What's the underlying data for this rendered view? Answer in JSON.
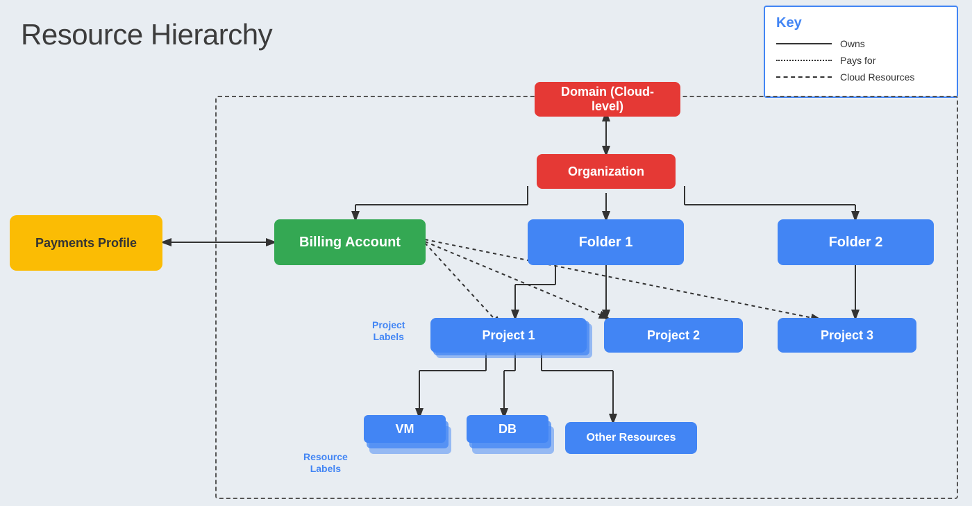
{
  "title": "Resource Hierarchy",
  "key": {
    "title": "Key",
    "items": [
      {
        "label": "Owns",
        "type": "solid"
      },
      {
        "label": "Pays for",
        "type": "dotted"
      },
      {
        "label": "Cloud Resources",
        "type": "dashed"
      }
    ]
  },
  "nodes": {
    "domain": "Domain (Cloud-level)",
    "organization": "Organization",
    "billing_account": "Billing Account",
    "payments_profile": "Payments Profile",
    "folder1": "Folder 1",
    "folder2": "Folder 2",
    "project1": "Project 1",
    "project2": "Project 2",
    "project3": "Project 3",
    "vm": "VM",
    "db": "DB",
    "other_resources": "Other Resources",
    "project_labels": "Project\nLabels",
    "resource_labels": "Resource\nLabels"
  }
}
